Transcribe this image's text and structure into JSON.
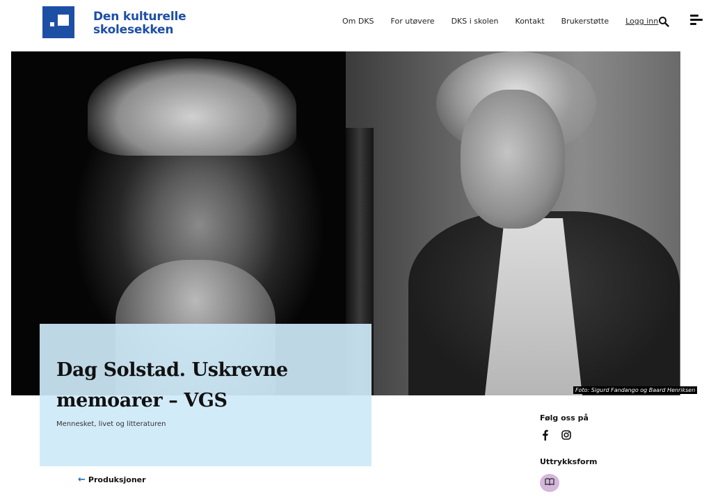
{
  "brand": {
    "name_line1": "Den kulturelle",
    "name_line2": "skolesekken",
    "color": "#1d4fa5"
  },
  "nav": {
    "items": [
      "Om DKS",
      "For utøvere",
      "DKS i skolen",
      "Kontakt",
      "Brukerstøtte"
    ],
    "login_label": "Logg inn"
  },
  "icons": {
    "search": "search-icon",
    "menu": "menu-icon",
    "facebook": "facebook-icon",
    "instagram": "instagram-icon",
    "expression_form": "book-icon"
  },
  "hero": {
    "photo_credit": "Foto: Sigurd Fandango og Baard Henriksen"
  },
  "production": {
    "title": "Dag Solstad. Uskrevne memoarer – VGS",
    "subtitle": "Mennesket, livet og litteraturen",
    "title_box_color": "#cee9f7"
  },
  "back": {
    "label": "Produksjoner"
  },
  "sidebar": {
    "follow_heading": "Følg oss på",
    "form_heading": "Uttrykksform",
    "form_badge_color": "#d5b7db"
  }
}
